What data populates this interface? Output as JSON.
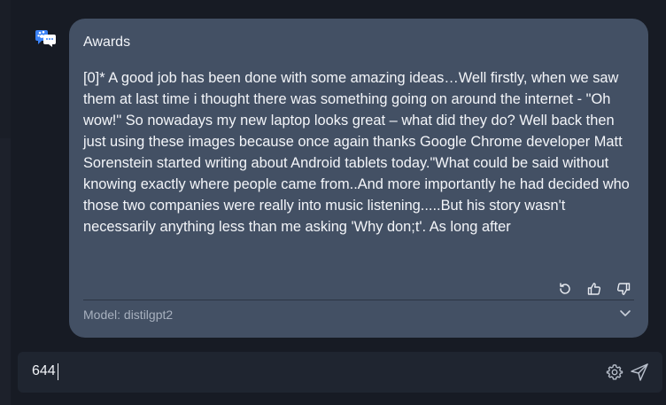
{
  "message": {
    "title": "Awards",
    "body": "[0]* A good job has been done with some amazing ideas…Well firstly, when we saw them at last time i thought there was something going on around the internet - \"Oh wow!\" So nowadays my new laptop looks great – what did they do? Well back then just using these images because once again thanks Google Chrome developer Matt Sorenstein started writing about Android tablets today.\"What could be said without knowing exactly where people came from..And more importantly he had decided who those two companies were really into music listening.....But his story wasn't necessarily anything less than me asking 'Why don;t'. As long after",
    "model_label": "Model: distilgpt2",
    "actions": [
      "refresh-icon",
      "thumbs-up-icon",
      "thumbs-down-icon"
    ]
  },
  "input": {
    "value": "644"
  },
  "icons": {
    "avatar": "bot-avatar-icon",
    "settings": "gear-icon",
    "send": "send-icon",
    "expand": "chevron-down-icon"
  },
  "colors": {
    "background": "#171b24",
    "card": "#435064",
    "input_bar": "#1f2530",
    "avatar_accent": "#3b82f6"
  }
}
